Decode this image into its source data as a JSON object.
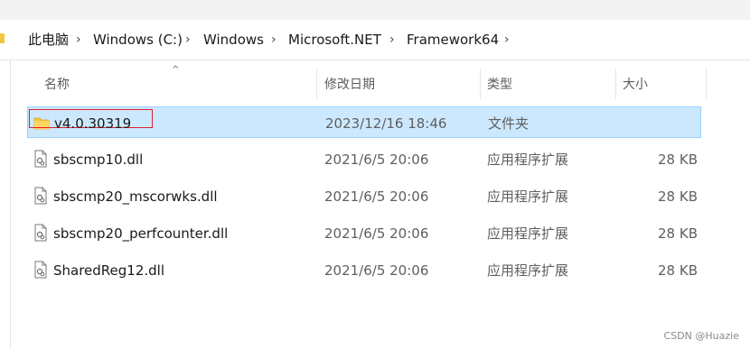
{
  "breadcrumb": [
    "此电脑",
    "Windows (C:)",
    "Windows",
    "Microsoft.NET",
    "Framework64"
  ],
  "columns": {
    "name": "名称",
    "date": "修改日期",
    "type": "类型",
    "size": "大小"
  },
  "files": [
    {
      "name": "v4.0.30319",
      "date": "2023/12/16 18:46",
      "type": "文件夹",
      "size": "",
      "icon": "folder-icon",
      "selected": true
    },
    {
      "name": "sbscmp10.dll",
      "date": "2021/6/5 20:06",
      "type": "应用程序扩展",
      "size": "28 KB",
      "icon": "dll-file-icon"
    },
    {
      "name": "sbscmp20_mscorwks.dll",
      "date": "2021/6/5 20:06",
      "type": "应用程序扩展",
      "size": "28 KB",
      "icon": "dll-file-icon"
    },
    {
      "name": "sbscmp20_perfcounter.dll",
      "date": "2021/6/5 20:06",
      "type": "应用程序扩展",
      "size": "28 KB",
      "icon": "dll-file-icon"
    },
    {
      "name": "SharedReg12.dll",
      "date": "2021/6/5 20:06",
      "type": "应用程序扩展",
      "size": "28 KB",
      "icon": "dll-file-icon"
    }
  ],
  "watermark": "CSDN @Huazie",
  "colors": {
    "selection": "#cce8ff",
    "selection_border": "#99d1ff",
    "highlight_box": "#e0202a",
    "folder": "#f4c542"
  }
}
